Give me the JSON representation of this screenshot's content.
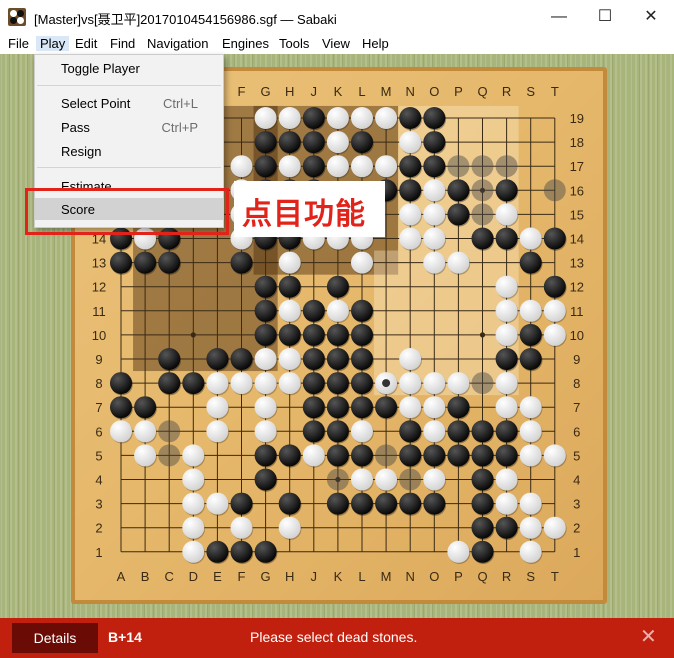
{
  "window": {
    "title": "[Master]vs[聂卫平]2017010454156986.sgf — Sabaki",
    "controls": {
      "minimize": "—",
      "maximize": "☐",
      "close": "✕"
    }
  },
  "menubar": [
    "File",
    "Play",
    "Edit",
    "Find",
    "Navigation",
    "Engines",
    "Tools",
    "View",
    "Help"
  ],
  "dropdown": {
    "toggle_player": "Toggle Player",
    "select_point": "Select Point",
    "select_point_shortcut": "Ctrl+L",
    "pass": "Pass",
    "pass_shortcut": "Ctrl+P",
    "resign": "Resign",
    "estimate": "Estimate",
    "score": "Score"
  },
  "annotation": {
    "callout": "点目功能"
  },
  "board": {
    "size": 19,
    "columns": [
      "A",
      "B",
      "C",
      "D",
      "E",
      "F",
      "G",
      "H",
      "J",
      "K",
      "L",
      "M",
      "N",
      "O",
      "P",
      "Q",
      "R",
      "S",
      "T"
    ],
    "rows": [
      "19",
      "18",
      "17",
      "16",
      "15",
      "14",
      "13",
      "12",
      "11",
      "10",
      "9",
      "8",
      "7",
      "6",
      "5",
      "4",
      "3",
      "2",
      "1"
    ],
    "stones_by_row_top_to_bottom": [
      "......WWBWWWBB.....",
      "......BBBWB.WB.....",
      ".....WBWBWWWBBddd..",
      ".....WBBB..BBWBdB.d",
      ".....WBWWWB.WWBdW..",
      "BWB..WBBWWW.WW.BBWB",
      "BBB..B.W..W..WW..B.",
      "......BB.B......W.B",
      "......BWBWB.....WWW",
      "......BBBBB.....WBW",
      "..B.BBWWBBB.W...BB.",
      "B.BBWWWWBBBWWWWdW..",
      "BB..W.W.BBBBWWB.WW.",
      "WWd.W.W.BBW.BWBBBW.",
      ".WdW..BBWBBdBBBBBWW",
      "...W..B..dWWdW.BW..",
      "...WWB.B.BBBBB.BWW.",
      "...W.W.W.......BBWW",
      "...WBBB.......WB.W."
    ],
    "last_move": "M8",
    "legend": "B = black stone, W = white stone, d = dimmed dead stone"
  },
  "statusbar": {
    "details_label": "Details",
    "score": "B+14",
    "message": "Please select dead stones.",
    "close": "✕"
  }
}
